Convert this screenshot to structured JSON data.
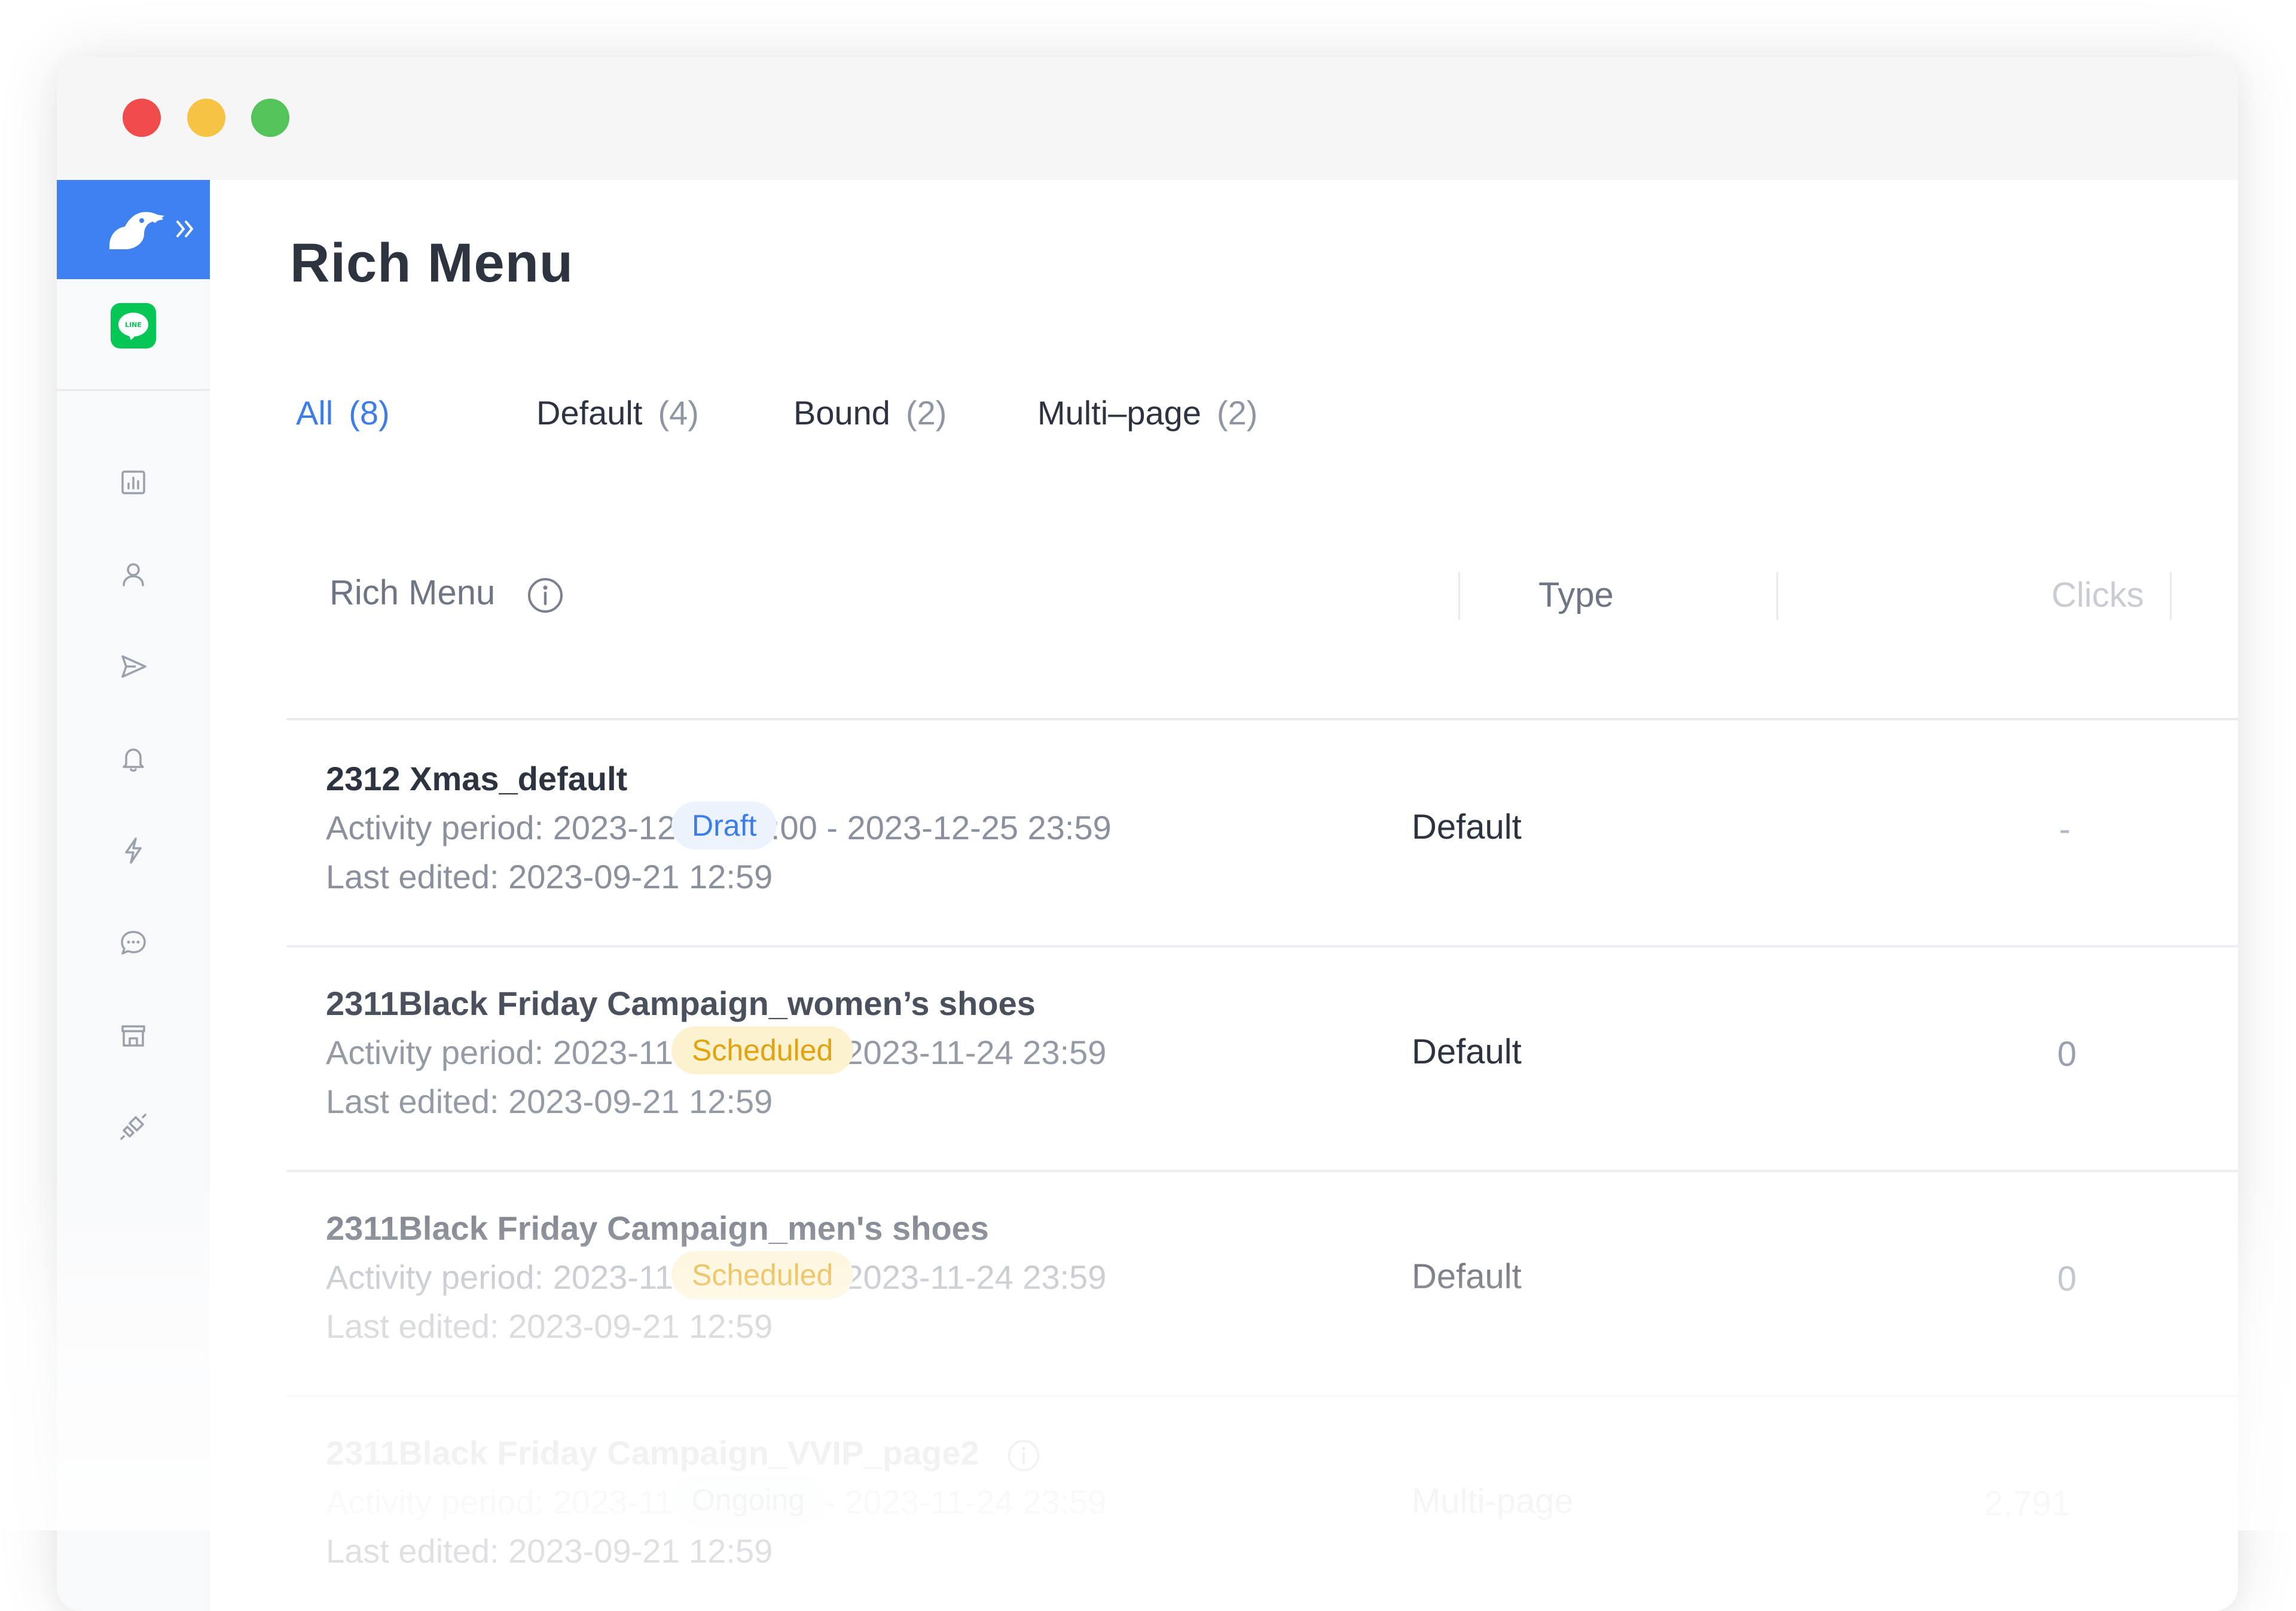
{
  "window": {
    "controls": [
      "close",
      "minimize",
      "maximize"
    ]
  },
  "sidebar": {
    "brand_icon": "pelican-logo-icon",
    "expand_icon": "double-chevron-right-icon",
    "channel": {
      "icon": "line-app-icon",
      "label": "LINE"
    },
    "nav": [
      {
        "id": "analytics",
        "icon": "bar-chart-icon"
      },
      {
        "id": "contacts",
        "icon": "user-icon"
      },
      {
        "id": "broadcast",
        "icon": "send-icon"
      },
      {
        "id": "notifications",
        "icon": "bell-icon"
      },
      {
        "id": "automation",
        "icon": "lightning-icon"
      },
      {
        "id": "chat",
        "icon": "chat-bubble-icon"
      },
      {
        "id": "store",
        "icon": "storefront-icon"
      },
      {
        "id": "integrations",
        "icon": "plug-icon"
      }
    ]
  },
  "page": {
    "title": "Rich Menu"
  },
  "tabs": [
    {
      "label": "All",
      "count": "(8)",
      "active": true
    },
    {
      "label": "Default",
      "count": "(4)",
      "active": false
    },
    {
      "label": "Bound",
      "count": "(2)",
      "active": false
    },
    {
      "label": "Multi–page",
      "count": "(2)",
      "active": false
    }
  ],
  "table": {
    "columns": {
      "name": "Rich Menu",
      "type": "Type",
      "clicks": "Clicks"
    },
    "rows": [
      {
        "name": "2312 Xmas_default",
        "period": "Activity period: 2023-12-20 00:00 - 2023-12-25 23:59",
        "edited": "Last edited: 2023-09-21 12:59",
        "status": "Draft",
        "type": "Default",
        "clicks": "-"
      },
      {
        "name": "2311Black Friday Campaign_women’s shoes",
        "period": "Activity period: 2023-11-20 00:00 - 2023-11-24 23:59",
        "edited": "Last edited: 2023-09-21 12:59",
        "status": "Scheduled",
        "type": "Default",
        "clicks": "0"
      },
      {
        "name": "2311Black Friday Campaign_men's shoes",
        "period": "Activity period: 2023-11-20 00:00 - 2023-11-24 23:59",
        "edited": "Last edited: 2023-09-21 12:59",
        "status": "Scheduled",
        "type": "Default",
        "clicks": "0"
      },
      {
        "name": "2311Black Friday Campaign_VVIP_page2",
        "period": "Activity period: 2023-11-20 00:00 - 2023-11-24 23:59",
        "edited": "Last edited: 2023-09-21 12:59",
        "status": "Ongoing",
        "type": "Multi-page",
        "clicks": "2,791"
      }
    ]
  },
  "colors": {
    "accent": "#3d82f0",
    "line_green": "#06c755",
    "draft_text": "#3d7de8",
    "scheduled_text": "#e3a30e"
  }
}
